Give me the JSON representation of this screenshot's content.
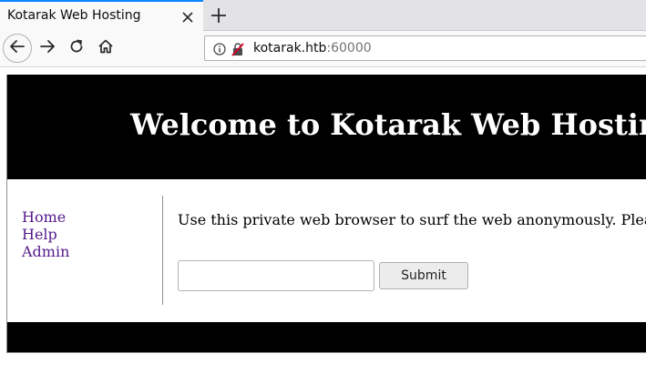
{
  "browser": {
    "tab_title": "Kotarak Web Hosting",
    "url_host": "kotarak.htb",
    "url_port": ":60000"
  },
  "page": {
    "header_title": "Welcome to Kotarak Web Hosting",
    "nav": [
      {
        "label": "Home"
      },
      {
        "label": "Help"
      },
      {
        "label": "Admin"
      }
    ],
    "intro_text": "Use this private web browser to surf the web anonymously. Please",
    "input_value": "",
    "submit_label": "Submit"
  },
  "colors": {
    "accent_tab": "#0a84ff",
    "header_bg": "#000000",
    "link_visited": "#551a8b"
  },
  "icons": [
    "close-icon",
    "plus-icon",
    "back-arrow-icon",
    "forward-arrow-icon",
    "reload-icon",
    "home-icon",
    "info-icon",
    "insecure-lock-icon"
  ]
}
